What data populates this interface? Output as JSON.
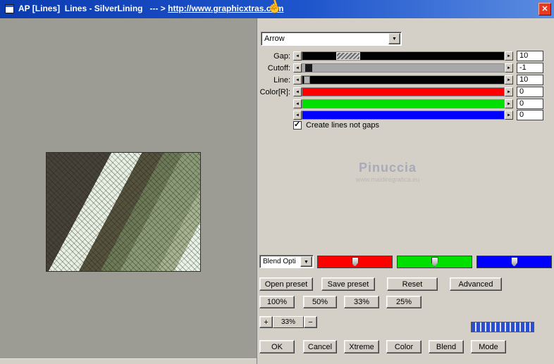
{
  "window": {
    "title_prefix": "AP [Lines]  Lines - SilverLining   --- > ",
    "title_url": "http://www.graphicxtras.com"
  },
  "icons": {
    "close": "✕",
    "dropdown_arrow": "▼",
    "left_arrow": "◄",
    "right_arrow": "►",
    "hand_cursor": "☝",
    "check": "✓"
  },
  "shape_dropdown": {
    "value": "Arrow"
  },
  "sliders": [
    {
      "label": "Gap:",
      "value": "10",
      "track_color": "#000000"
    },
    {
      "label": "Cutoff:",
      "value": "-1",
      "track_color": "#a8a8a8"
    },
    {
      "label": "Line:",
      "value": "10",
      "track_color": "#000000"
    },
    {
      "label": "Color[R]:",
      "value": "0",
      "track_color": "#ff0000"
    },
    {
      "label": "",
      "value": "0",
      "track_color": "#00e000"
    },
    {
      "label": "",
      "value": "0",
      "track_color": "#0000ff"
    }
  ],
  "options": {
    "create_lines_label": "Create lines not gaps",
    "checked": true
  },
  "watermark": {
    "name": "Pinuccia",
    "site": "www.maidiregrafica.eu"
  },
  "blend_dropdown": {
    "value": "Blend Opti"
  },
  "channel_bars": [
    {
      "name": "red",
      "color": "#ff0000"
    },
    {
      "name": "green",
      "color": "#00e000"
    },
    {
      "name": "blue",
      "color": "#0000ff"
    }
  ],
  "preset_buttons": {
    "open": "Open preset",
    "save": "Save preset",
    "reset": "Reset",
    "advanced": "Advanced"
  },
  "zoom_buttons": [
    "100%",
    "50%",
    "33%",
    "25%"
  ],
  "zoom_stepper": {
    "plus": "+",
    "value": "33%",
    "minus": "−"
  },
  "action_buttons": {
    "ok": "OK",
    "cancel": "Cancel",
    "xtreme": "Xtreme",
    "color": "Color",
    "blend": "Blend",
    "mode": "Mode"
  }
}
